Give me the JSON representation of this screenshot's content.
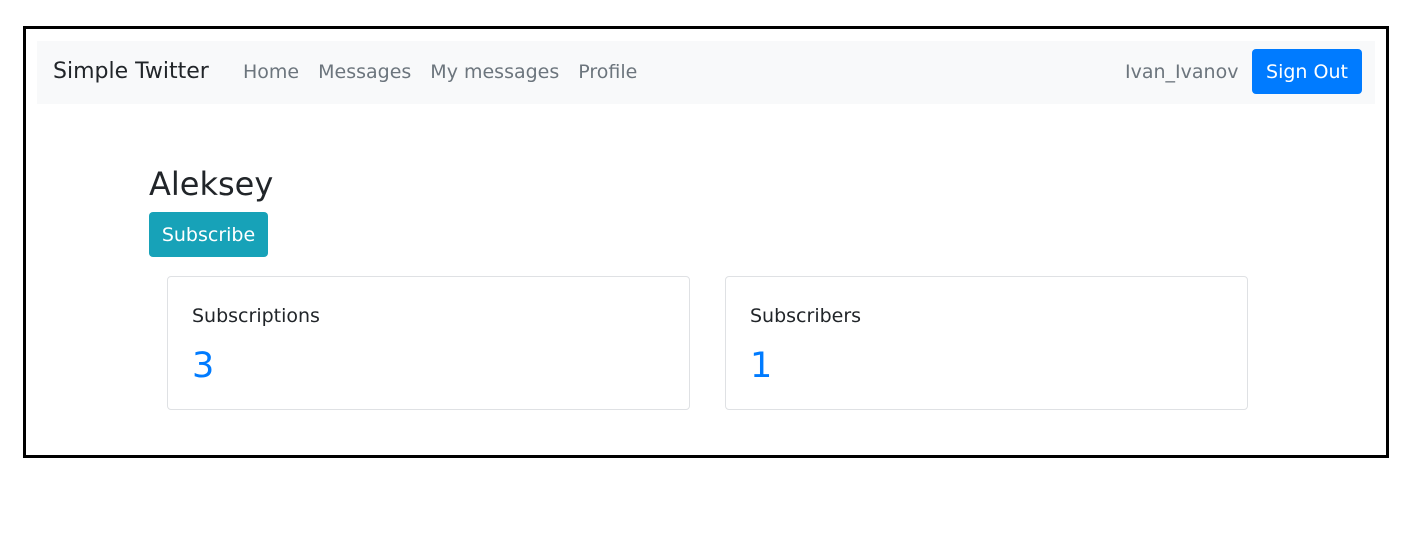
{
  "navbar": {
    "brand": "Simple Twitter",
    "links": [
      {
        "label": "Home"
      },
      {
        "label": "Messages"
      },
      {
        "label": "My messages"
      },
      {
        "label": "Profile"
      }
    ],
    "username": "Ivan_Ivanov",
    "sign_out_label": "Sign Out"
  },
  "profile": {
    "name": "Aleksey",
    "subscribe_label": "Subscribe"
  },
  "stats": [
    {
      "label": "Subscriptions",
      "count": "3"
    },
    {
      "label": "Subscribers",
      "count": "1"
    }
  ],
  "colors": {
    "primary": "#007bff",
    "info": "#17a2b8",
    "navbar_bg": "#f8f9fa",
    "muted": "#6c757d"
  }
}
